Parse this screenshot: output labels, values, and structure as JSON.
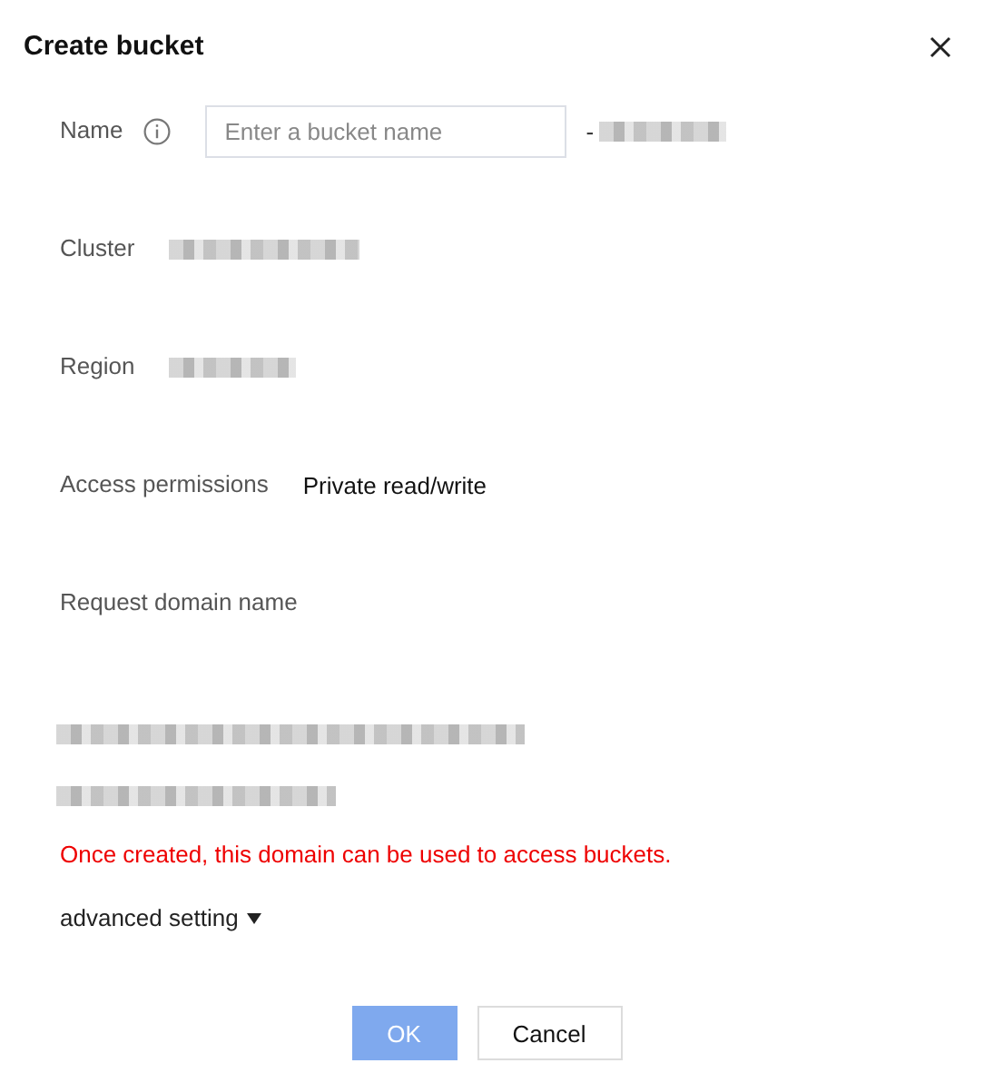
{
  "dialog": {
    "title": "Create bucket"
  },
  "fields": [
    {
      "kind": "input",
      "label": "Name",
      "info": true,
      "placeholder": "Enter a bucket name",
      "separator": "-",
      "suffix_redacted": true
    },
    {
      "kind": "redacted",
      "label": "Cluster",
      "redacted": true
    },
    {
      "kind": "redacted",
      "label": "Region",
      "redacted": true
    },
    {
      "kind": "text",
      "label": "Access permissions",
      "value": "Private read/write"
    },
    {
      "kind": "domain",
      "label": "Request domain name",
      "values": [
        {
          "redacted": true
        },
        {
          "redacted": true
        }
      ]
    }
  ],
  "note": {
    "kind": "error",
    "text": "Once created, this domain can be used to access buckets."
  },
  "advanced": {
    "label": "advanced setting",
    "expanded": false
  },
  "buttons": [
    {
      "label": "OK",
      "kind": "primary",
      "disabled": true
    },
    {
      "label": "Cancel",
      "kind": "default",
      "disabled": false
    }
  ]
}
